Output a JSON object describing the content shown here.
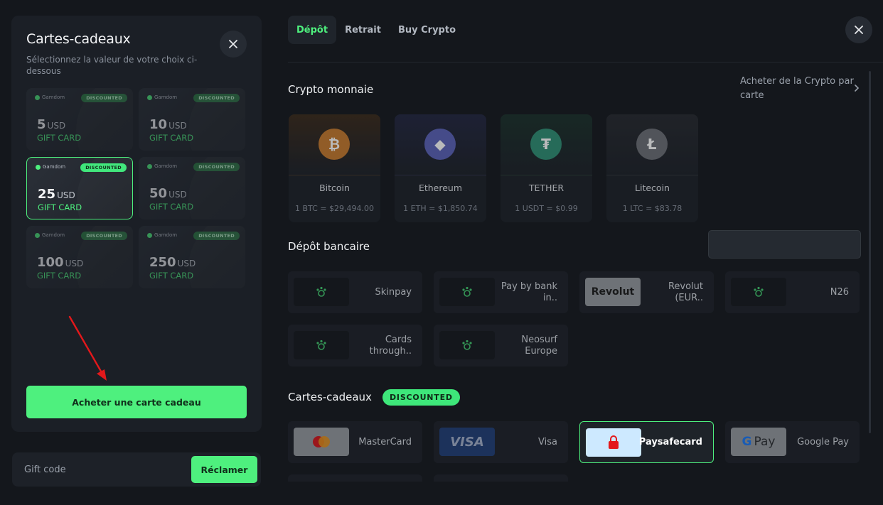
{
  "gift_panel": {
    "title": "Cartes-cadeaux",
    "subtitle": "Sélectionnez la valeur de votre choix ci-dessous",
    "brand": "Gamdom",
    "cards": [
      {
        "amount": "5",
        "currency": "USD",
        "label": "GIFT CARD",
        "badge": "DISCOUNTED",
        "selected": false
      },
      {
        "amount": "10",
        "currency": "USD",
        "label": "GIFT CARD",
        "badge": "DISCOUNTED",
        "selected": false
      },
      {
        "amount": "25",
        "currency": "USD",
        "label": "GIFT CARD",
        "badge": "DISCOUNTED",
        "selected": true
      },
      {
        "amount": "50",
        "currency": "USD",
        "label": "GIFT CARD",
        "badge": "DISCOUNTED",
        "selected": false
      },
      {
        "amount": "100",
        "currency": "USD",
        "label": "GIFT CARD",
        "badge": "DISCOUNTED",
        "selected": false
      },
      {
        "amount": "250",
        "currency": "USD",
        "label": "GIFT CARD",
        "badge": "DISCOUNTED",
        "selected": false
      }
    ],
    "buy_button": "Acheter une carte cadeau",
    "code_placeholder": "Gift code",
    "claim_button": "Réclamer"
  },
  "deposit": {
    "tabs": [
      {
        "label": "Dépôt",
        "active": true
      },
      {
        "label": "Retrait",
        "active": false
      },
      {
        "label": "Buy Crypto",
        "active": false
      }
    ],
    "crypto_section": {
      "title": "Crypto monnaie",
      "buy_link": "Acheter de la Crypto par carte",
      "coins": [
        {
          "name": "Bitcoin",
          "rate": "1 BTC = $29,494.00",
          "symbol": "₿",
          "color": "#c77a2c",
          "glow": "#3a2a1a"
        },
        {
          "name": "Ethereum",
          "rate": "1 ETH = $1,850.74",
          "symbol": "◆",
          "color": "#5b62b8",
          "glow": "#22263f"
        },
        {
          "name": "TETHER",
          "rate": "1 USDT = $0.99",
          "symbol": "₮",
          "color": "#2f8f74",
          "glow": "#1b3029"
        },
        {
          "name": "Litecoin",
          "rate": "1 LTC = $83.78",
          "symbol": "Ł",
          "color": "#6b6f75",
          "glow": "#26292e"
        }
      ]
    },
    "bank_section": {
      "title": "Dépôt bancaire",
      "methods": [
        {
          "name": "Skinpay",
          "logo": "paw-icon"
        },
        {
          "name": "Pay by bank in..",
          "logo": "paw-icon"
        },
        {
          "name": "Revolut (EUR..",
          "logo": "revolut-logo",
          "logo_text": "Revolut"
        },
        {
          "name": "N26",
          "logo": "paw-icon"
        },
        {
          "name": "Cards through..",
          "logo": "paw-icon"
        },
        {
          "name": "Neosurf Europe",
          "logo": "paw-icon"
        }
      ]
    },
    "gift_section": {
      "title": "Cartes-cadeaux",
      "badge": "DISCOUNTED",
      "methods": [
        {
          "name": "MasterCard",
          "logo": "mastercard-logo",
          "selected": false
        },
        {
          "name": "Visa",
          "logo": "visa-logo",
          "logo_text": "VISA",
          "selected": false
        },
        {
          "name": "Paysafecard",
          "logo": "paysafecard-logo",
          "selected": true
        },
        {
          "name": "Google Pay",
          "logo": "google-pay-logo",
          "logo_text": "Pay",
          "selected": false
        }
      ]
    }
  },
  "colors": {
    "accent": "#4ef07e",
    "background": "#14171c",
    "panel": "#1b1f26",
    "annotation_arrow": "#e3181b"
  }
}
